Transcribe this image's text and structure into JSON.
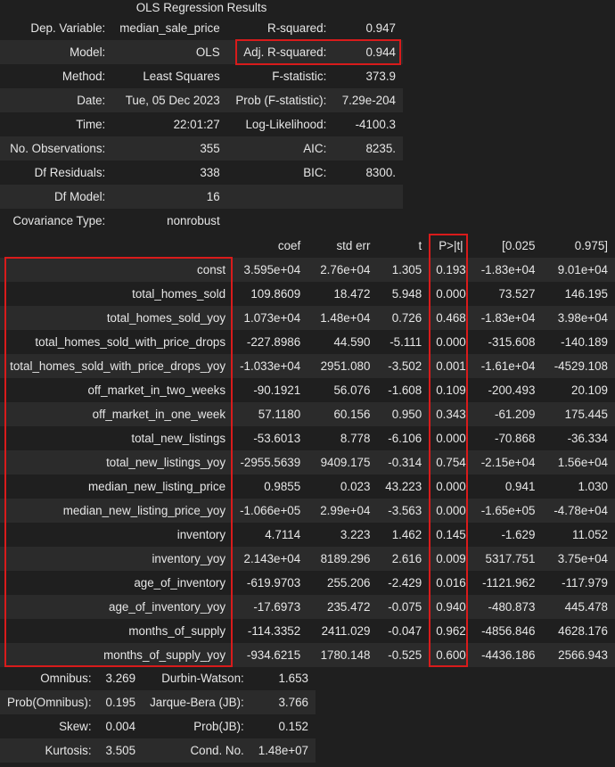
{
  "title": "OLS Regression Results",
  "summary": [
    [
      "Dep. Variable:",
      "median_sale_price",
      "R-squared:",
      "0.947"
    ],
    [
      "Model:",
      "OLS",
      "Adj. R-squared:",
      "0.944"
    ],
    [
      "Method:",
      "Least Squares",
      "F-statistic:",
      "373.9"
    ],
    [
      "Date:",
      "Tue, 05 Dec 2023",
      "Prob (F-statistic):",
      "7.29e-204"
    ],
    [
      "Time:",
      "22:01:27",
      "Log-Likelihood:",
      "-4100.3"
    ],
    [
      "No. Observations:",
      "355",
      "AIC:",
      "8235."
    ],
    [
      "Df Residuals:",
      "338",
      "BIC:",
      "8300."
    ],
    [
      "Df Model:",
      "16",
      "",
      ""
    ],
    [
      "Covariance Type:",
      "nonrobust",
      "",
      ""
    ]
  ],
  "coef_headers": [
    "",
    "coef",
    "std err",
    "t",
    "P>|t|",
    "[0.025",
    "0.975]"
  ],
  "coef_rows": [
    [
      "const",
      "3.595e+04",
      "2.76e+04",
      "1.305",
      "0.193",
      "-1.83e+04",
      "9.01e+04"
    ],
    [
      "total_homes_sold",
      "109.8609",
      "18.472",
      "5.948",
      "0.000",
      "73.527",
      "146.195"
    ],
    [
      "total_homes_sold_yoy",
      "1.073e+04",
      "1.48e+04",
      "0.726",
      "0.468",
      "-1.83e+04",
      "3.98e+04"
    ],
    [
      "total_homes_sold_with_price_drops",
      "-227.8986",
      "44.590",
      "-5.111",
      "0.000",
      "-315.608",
      "-140.189"
    ],
    [
      "total_homes_sold_with_price_drops_yoy",
      "-1.033e+04",
      "2951.080",
      "-3.502",
      "0.001",
      "-1.61e+04",
      "-4529.108"
    ],
    [
      "off_market_in_two_weeks",
      "-90.1921",
      "56.076",
      "-1.608",
      "0.109",
      "-200.493",
      "20.109"
    ],
    [
      "off_market_in_one_week",
      "57.1180",
      "60.156",
      "0.950",
      "0.343",
      "-61.209",
      "175.445"
    ],
    [
      "total_new_listings",
      "-53.6013",
      "8.778",
      "-6.106",
      "0.000",
      "-70.868",
      "-36.334"
    ],
    [
      "total_new_listings_yoy",
      "-2955.5639",
      "9409.175",
      "-0.314",
      "0.754",
      "-2.15e+04",
      "1.56e+04"
    ],
    [
      "median_new_listing_price",
      "0.9855",
      "0.023",
      "43.223",
      "0.000",
      "0.941",
      "1.030"
    ],
    [
      "median_new_listing_price_yoy",
      "-1.066e+05",
      "2.99e+04",
      "-3.563",
      "0.000",
      "-1.65e+05",
      "-4.78e+04"
    ],
    [
      "inventory",
      "4.7114",
      "3.223",
      "1.462",
      "0.145",
      "-1.629",
      "11.052"
    ],
    [
      "inventory_yoy",
      "2.143e+04",
      "8189.296",
      "2.616",
      "0.009",
      "5317.751",
      "3.75e+04"
    ],
    [
      "age_of_inventory",
      "-619.9703",
      "255.206",
      "-2.429",
      "0.016",
      "-1121.962",
      "-117.979"
    ],
    [
      "age_of_inventory_yoy",
      "-17.6973",
      "235.472",
      "-0.075",
      "0.940",
      "-480.873",
      "445.478"
    ],
    [
      "months_of_supply",
      "-114.3352",
      "2411.029",
      "-0.047",
      "0.962",
      "-4856.846",
      "4628.176"
    ],
    [
      "months_of_supply_yoy",
      "-934.6215",
      "1780.148",
      "-0.525",
      "0.600",
      "-4436.186",
      "2566.943"
    ]
  ],
  "diagnostics": [
    [
      "Omnibus:",
      "3.269",
      "Durbin-Watson:",
      "1.653"
    ],
    [
      "Prob(Omnibus):",
      "0.195",
      "Jarque-Bera (JB):",
      "3.766"
    ],
    [
      "Skew:",
      "0.004",
      "Prob(JB):",
      "0.152"
    ],
    [
      "Kurtosis:",
      "3.505",
      "Cond. No.",
      "1.48e+07"
    ]
  ],
  "highlight_color": "#d81b1b"
}
